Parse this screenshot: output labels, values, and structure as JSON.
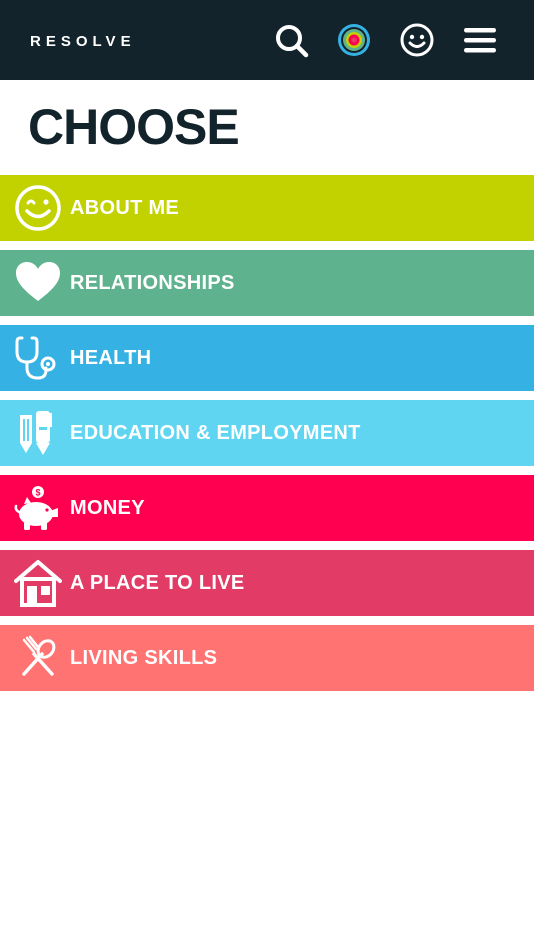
{
  "header": {
    "brand": "RESOLVE",
    "icons": {
      "search": "search-icon",
      "target": "target-icon",
      "smiley": "smiley-icon",
      "menu": "hamburger-menu-icon"
    },
    "background": "#12232b"
  },
  "page": {
    "title": "CHOOSE"
  },
  "categories": [
    {
      "label": "ABOUT ME",
      "icon": "smiley-face-icon",
      "color": "#c1d200"
    },
    {
      "label": "RELATIONSHIPS",
      "icon": "heart-icon",
      "color": "#5eb38e"
    },
    {
      "label": "HEALTH",
      "icon": "stethoscope-icon",
      "color": "#36b1e3"
    },
    {
      "label": "EDUCATION & EMPLOYMENT",
      "icon": "pencil-pen-icon",
      "color": "#5fd5f2"
    },
    {
      "label": "MONEY",
      "icon": "piggy-bank-icon",
      "color": "#ff0050"
    },
    {
      "label": "A PLACE TO LIVE",
      "icon": "house-icon",
      "color": "#e23b65"
    },
    {
      "label": "LIVING SKILLS",
      "icon": "utensils-icon",
      "color": "#ff7373"
    }
  ]
}
